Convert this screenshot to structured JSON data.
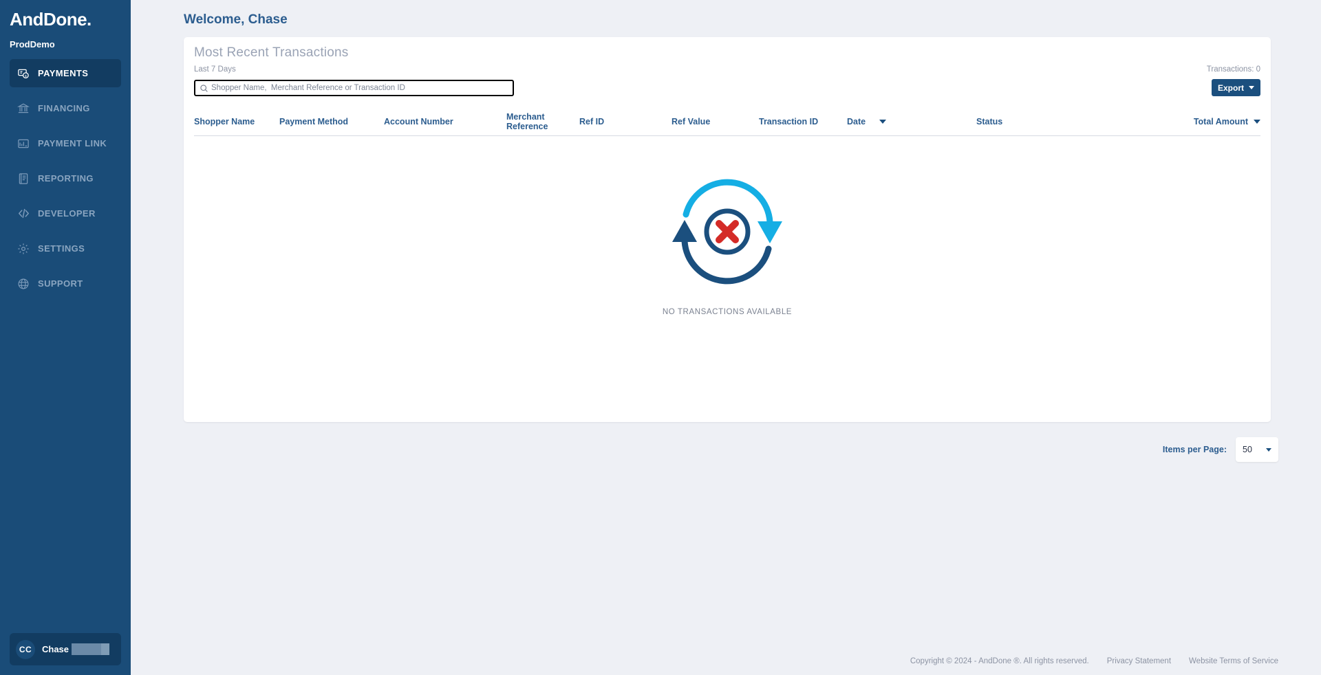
{
  "sidebar": {
    "logo": "AndDone",
    "logo_dot": ".",
    "tenant": "ProdDemo",
    "items": [
      {
        "label": "PAYMENTS",
        "icon": "payments-icon",
        "active": true
      },
      {
        "label": "FINANCING",
        "icon": "bank-icon",
        "active": false
      },
      {
        "label": "PAYMENT LINK",
        "icon": "link-card-icon",
        "active": false
      },
      {
        "label": "REPORTING",
        "icon": "report-icon",
        "active": false
      },
      {
        "label": "DEVELOPER",
        "icon": "code-icon",
        "active": false
      },
      {
        "label": "SETTINGS",
        "icon": "gear-icon",
        "active": false
      },
      {
        "label": "SUPPORT",
        "icon": "globe-icon",
        "active": false
      }
    ],
    "profile": {
      "initials": "CC",
      "name": "Chase",
      "redacted": true
    }
  },
  "header": {
    "welcome": "Welcome, Chase"
  },
  "card": {
    "title": "Most Recent Transactions",
    "subtitle": "Last 7 Days",
    "transactions_count": "Transactions: 0",
    "search": {
      "placeholder": "Shopper Name,  Merchant Reference or Transaction ID",
      "value": "",
      "icon": "search-icon"
    },
    "export": {
      "label": "Export",
      "icon": "chevron-down-icon"
    },
    "columns": [
      {
        "label": "Shopper Name",
        "sort": "none",
        "align": "left"
      },
      {
        "label": "Payment Method",
        "sort": "none",
        "align": "left"
      },
      {
        "label": "Account Number",
        "sort": "none",
        "align": "left"
      },
      {
        "label": "Merchant Reference",
        "sort": "none",
        "align": "left"
      },
      {
        "label": "Ref ID",
        "sort": "none",
        "align": "left"
      },
      {
        "label": "Ref Value",
        "sort": "none",
        "align": "left"
      },
      {
        "label": "Transaction ID",
        "sort": "none",
        "align": "left"
      },
      {
        "label": "Date",
        "sort": "desc",
        "align": "left"
      },
      {
        "label": "Status",
        "sort": "none",
        "align": "left"
      },
      {
        "label": "Total Amount",
        "sort": "desc",
        "align": "right"
      }
    ],
    "empty_state": {
      "label": "NO TRANSACTIONS AVAILABLE",
      "illustration": "no-transactions-icon"
    }
  },
  "pagination": {
    "label": "Items per Page:",
    "value": "50",
    "icon": "chevron-down-icon"
  },
  "footer": {
    "copyright": "Copyright © 2024 - AndDone ®. All rights reserved.",
    "privacy": "Privacy Statement",
    "terms": "Website Terms of Service"
  },
  "colors": {
    "sidebar_bg": "#1a4c78",
    "sidebar_active": "#123c61",
    "accent_blue": "#2c5d8f",
    "button_blue": "#1b4f7e",
    "page_bg": "#eef0f5",
    "illus_dark": "#1b4f7e",
    "illus_light": "#15aee4",
    "illus_red": "#d42b27"
  }
}
